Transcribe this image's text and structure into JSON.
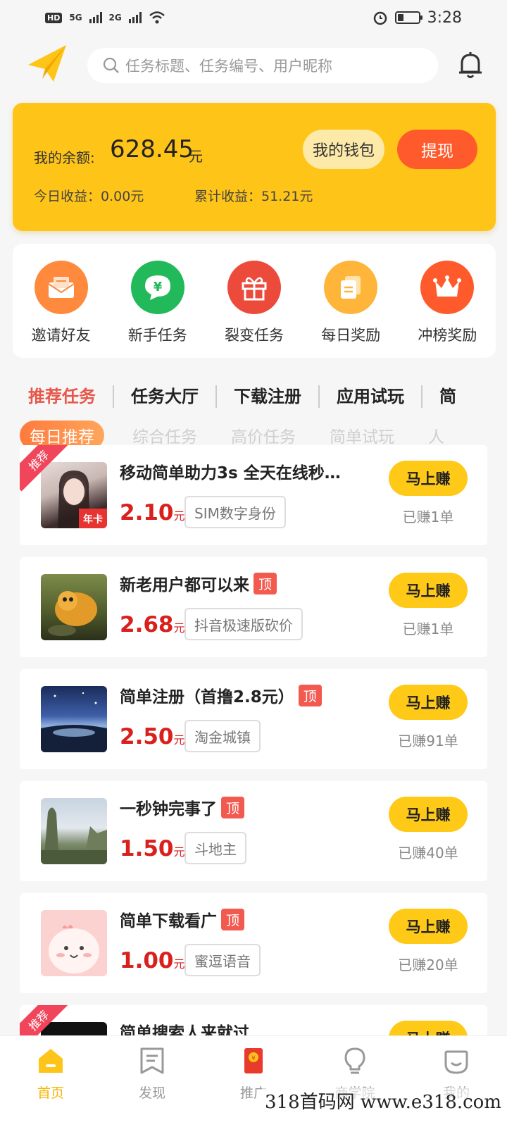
{
  "status_bar": {
    "hd": "HD",
    "net1": "5G",
    "net2": "2G",
    "time": "3:28"
  },
  "search": {
    "placeholder": "任务标题、任务编号、用户昵称"
  },
  "balance": {
    "label": "我的余额:",
    "value": "628.45",
    "unit": "元",
    "wallet_label": "我的钱包",
    "withdraw_label": "提现",
    "today": "今日收益：0.00元",
    "total": "累计收益：51.21元"
  },
  "quick": [
    {
      "label": "邀请好友",
      "icon": "mail-icon",
      "color": "#ff8a3d"
    },
    {
      "label": "新手任务",
      "icon": "yuan-chat-icon",
      "color": "#22b95a"
    },
    {
      "label": "裂变任务",
      "icon": "gift-icon",
      "color": "#ec4a3b"
    },
    {
      "label": "每日奖励",
      "icon": "cards-icon",
      "color": "#ffb43a"
    },
    {
      "label": "冲榜奖励",
      "icon": "crown-icon",
      "color": "#ff5a2c"
    }
  ],
  "tabs": [
    "推荐任务",
    "任务大厅",
    "下载注册",
    "应用试玩",
    "简"
  ],
  "subtabs": [
    "每日推荐",
    "综合任务",
    "高价任务",
    "简单试玩",
    "人"
  ],
  "tasks": [
    {
      "title": "移动简单助力3s 全天在线秒…",
      "top": "",
      "price": "2.10",
      "unit": "元",
      "app": "SIM数字身份",
      "earn": "马上赚",
      "earned": "已赚1单",
      "ribbon": "推荐",
      "badge": "年卡"
    },
    {
      "title": "新老用户都可以来",
      "top": "顶",
      "price": "2.68",
      "unit": "元",
      "app": "抖音极速版砍价",
      "earn": "马上赚",
      "earned": "已赚1单"
    },
    {
      "title": "简单注册（首撸2.8元）",
      "top": "顶",
      "price": "2.50",
      "unit": "元",
      "app": "淘金城镇",
      "earn": "马上赚",
      "earned": "已赚91单"
    },
    {
      "title": "一秒钟完事了",
      "top": "顶",
      "price": "1.50",
      "unit": "元",
      "app": "斗地主",
      "earn": "马上赚",
      "earned": "已赚40单"
    },
    {
      "title": "简单下载看广",
      "top": "顶",
      "price": "1.00",
      "unit": "元",
      "app": "蜜逗语音",
      "earn": "马上赚",
      "earned": "已赚20单"
    },
    {
      "title": "简单搜索人来就过",
      "top": "",
      "price": "",
      "unit": "",
      "app": "",
      "earn": "马上赚",
      "earned": "",
      "ribbon": "推荐"
    }
  ],
  "nav": [
    {
      "label": "首页",
      "icon": "home-icon"
    },
    {
      "label": "发现",
      "icon": "note-icon"
    },
    {
      "label": "推广",
      "icon": "envelope-icon"
    },
    {
      "label": "商学院",
      "icon": "bulb-icon"
    },
    {
      "label": "我的",
      "icon": "smile-icon"
    }
  ],
  "watermark": "318首码网  www.e318.com",
  "colors": {
    "accent": "#ffc418",
    "price": "#d9201c",
    "tab_active": "#e8564a",
    "withdraw": "#ff5a2c"
  }
}
